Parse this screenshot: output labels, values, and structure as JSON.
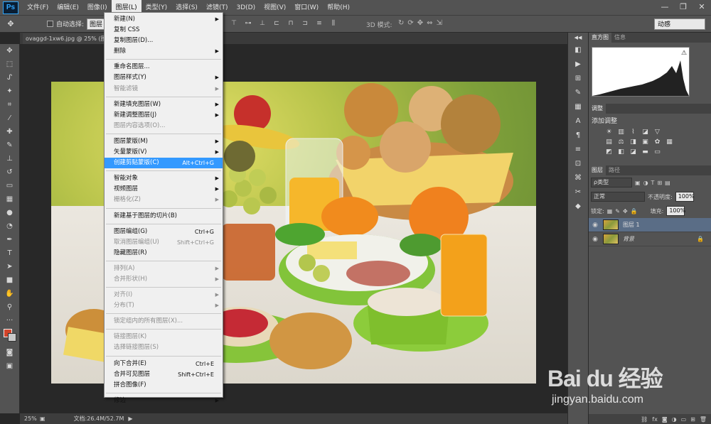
{
  "app": {
    "logo": "Ps"
  },
  "menubar": {
    "items": [
      "文件(F)",
      "编辑(E)",
      "图像(I)",
      "图层(L)",
      "类型(Y)",
      "选择(S)",
      "滤镜(T)",
      "3D(D)",
      "视图(V)",
      "窗口(W)",
      "帮助(H)"
    ],
    "active_index": 3
  },
  "window_controls": [
    "—",
    "❐",
    "✕"
  ],
  "options": {
    "auto_select_label": "自动选择:",
    "auto_select_value": "图层",
    "mode3d_label": "3D 模式:",
    "workspace": "动感"
  },
  "document": {
    "tab_title": "ovaggd-1xw6.jpg @ 25% (图",
    "zoom": "25%",
    "doc_info": "文档:26.4M/52.7M"
  },
  "layer_menu": [
    {
      "label": "新建(N)",
      "submenu": true
    },
    {
      "label": "复制 CSS"
    },
    {
      "label": "复制图层(D)..."
    },
    {
      "label": "删除",
      "submenu": true
    },
    {
      "sep": true
    },
    {
      "label": "重命名图层..."
    },
    {
      "label": "图层样式(Y)",
      "submenu": true
    },
    {
      "label": "智能滤镜",
      "submenu": true,
      "disabled": true
    },
    {
      "sep": true
    },
    {
      "label": "新建填充图层(W)",
      "submenu": true
    },
    {
      "label": "新建调整图层(J)",
      "submenu": true
    },
    {
      "label": "图层内容选项(O)...",
      "disabled": true
    },
    {
      "sep": true
    },
    {
      "label": "图层蒙版(M)",
      "submenu": true
    },
    {
      "label": "矢量蒙版(V)",
      "submenu": true
    },
    {
      "label": "创建剪贴蒙版(C)",
      "shortcut": "Alt+Ctrl+G",
      "highlight": true
    },
    {
      "sep": true
    },
    {
      "label": "智能对象",
      "submenu": true
    },
    {
      "label": "视频图层",
      "submenu": true
    },
    {
      "label": "栅格化(Z)",
      "submenu": true,
      "disabled": true
    },
    {
      "sep": true
    },
    {
      "label": "新建基于图层的切片(B)"
    },
    {
      "sep": true
    },
    {
      "label": "图层编组(G)",
      "shortcut": "Ctrl+G"
    },
    {
      "label": "取消图层编组(U)",
      "shortcut": "Shift+Ctrl+G",
      "disabled": true
    },
    {
      "label": "隐藏图层(R)"
    },
    {
      "sep": true
    },
    {
      "label": "排列(A)",
      "submenu": true,
      "disabled": true
    },
    {
      "label": "合并形状(H)",
      "submenu": true,
      "disabled": true
    },
    {
      "sep": true
    },
    {
      "label": "对齐(I)",
      "submenu": true,
      "disabled": true
    },
    {
      "label": "分布(T)",
      "submenu": true,
      "disabled": true
    },
    {
      "sep": true
    },
    {
      "label": "锁定组内的所有图层(X)...",
      "disabled": true
    },
    {
      "sep": true
    },
    {
      "label": "链接图层(K)",
      "disabled": true
    },
    {
      "label": "选择链接图层(S)",
      "disabled": true
    },
    {
      "sep": true
    },
    {
      "label": "向下合并(E)",
      "shortcut": "Ctrl+E"
    },
    {
      "label": "合并可见图层",
      "shortcut": "Shift+Ctrl+E"
    },
    {
      "label": "拼合图像(F)"
    },
    {
      "sep": true
    },
    {
      "label": "修边",
      "submenu": true
    }
  ],
  "panels": {
    "histogram_tabs": [
      "直方图",
      "信息"
    ],
    "adjust_tab": "调整",
    "adjust_title": "添加调整",
    "layers_tabs": [
      "图层",
      "路径"
    ],
    "filter_kind": "ρ类型",
    "blend_mode": "正常",
    "opacity_label": "不透明度:",
    "opacity_value": "100%",
    "lock_label": "锁定:",
    "fill_label": "填充:",
    "fill_value": "100%",
    "layers": [
      {
        "name": "图层 1",
        "selected": true
      },
      {
        "name": "背景",
        "locked": true
      }
    ]
  },
  "watermark": {
    "brand": "Bai du 经验",
    "url": "jingyan.baidu.com"
  },
  "icons": {
    "eye": "eye-icon",
    "lock": "lock-icon"
  }
}
